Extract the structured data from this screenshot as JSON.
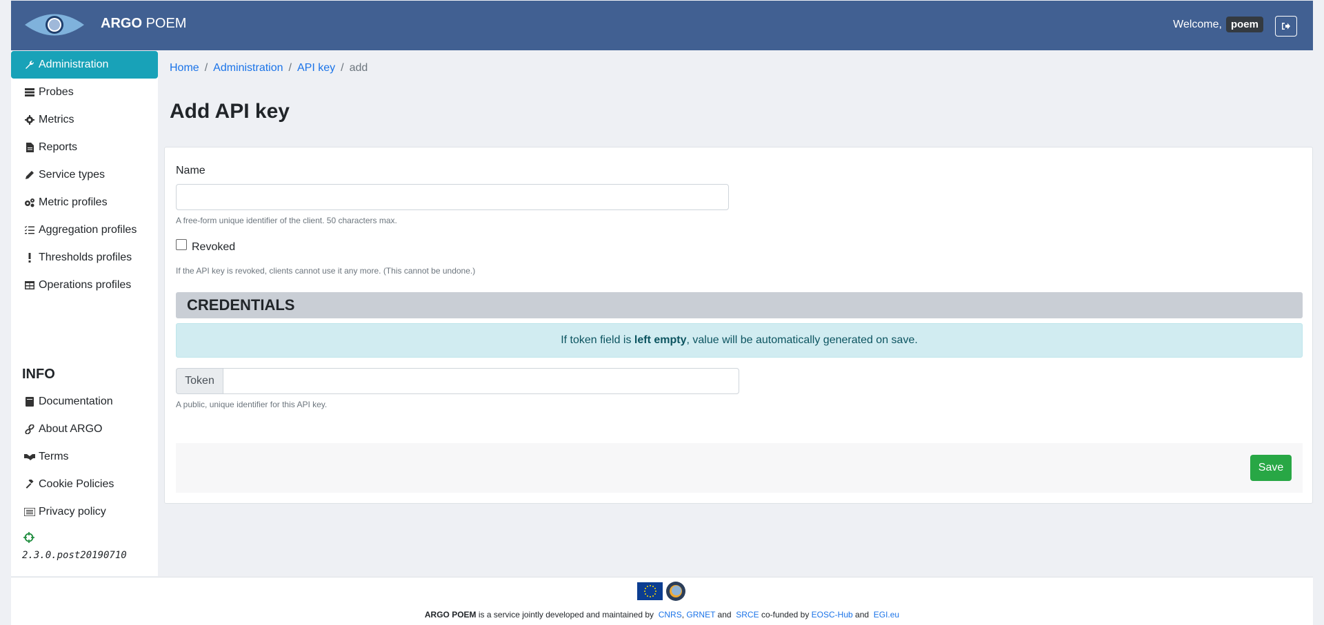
{
  "header": {
    "brand_bold": "ARGO",
    "brand_rest": "POEM",
    "welcome_text": "Welcome,",
    "username": "poem"
  },
  "sidebar": {
    "items": [
      {
        "label": "Administration",
        "icon": "wrench-icon"
      },
      {
        "label": "Probes",
        "icon": "server-icon"
      },
      {
        "label": "Metrics",
        "icon": "cog-icon"
      },
      {
        "label": "Reports",
        "icon": "file-icon"
      },
      {
        "label": "Service types",
        "icon": "pen-icon"
      },
      {
        "label": "Metric profiles",
        "icon": "cogs-icon"
      },
      {
        "label": "Aggregation profiles",
        "icon": "tasks-icon"
      },
      {
        "label": "Thresholds profiles",
        "icon": "exclamation-icon"
      },
      {
        "label": "Operations profiles",
        "icon": "table-icon"
      }
    ],
    "info_title": "INFO",
    "info_items": [
      {
        "label": "Documentation",
        "icon": "book-icon"
      },
      {
        "label": "About ARGO",
        "icon": "link-icon"
      },
      {
        "label": "Terms",
        "icon": "handshake-icon"
      },
      {
        "label": "Cookie Policies",
        "icon": "gavel-icon"
      },
      {
        "label": "Privacy policy",
        "icon": "list-icon"
      }
    ],
    "version": "2.3.0.post20190710"
  },
  "breadcrumb": {
    "home": "Home",
    "administration": "Administration",
    "api_key": "API key",
    "current": "add",
    "separator": "/"
  },
  "page": {
    "title": "Add API key"
  },
  "form": {
    "name_label": "Name",
    "name_value": "",
    "name_help": "A free-form unique identifier of the client. 50 characters max.",
    "revoked_label": "Revoked",
    "revoked_checked": false,
    "revoked_help": "If the API key is revoked, clients cannot use it any more. (This cannot be undone.)",
    "credentials_title": "CREDENTIALS",
    "alert_prefix": "If token field is ",
    "alert_bold": "left empty",
    "alert_suffix": ", value will be automatically generated on save.",
    "token_label": "Token",
    "token_value": "",
    "token_help": "A public, unique identifier for this API key.",
    "save_label": "Save"
  },
  "footer": {
    "brand": "ARGO POEM",
    "text1": " is a service jointly developed and maintained by ",
    "cnrs": "CNRS",
    "comma": ",",
    "grnet": "GRNET",
    "and1": " and ",
    "srce": "SRCE",
    "cofunded": " co-funded by ",
    "eosc": "EOSC-Hub",
    "and2": " and ",
    "egi": "EGI.eu"
  },
  "colors": {
    "header_bg": "#416092",
    "active_nav": "#18a2b8",
    "save_button": "#28a745",
    "link": "#1a73e8"
  }
}
